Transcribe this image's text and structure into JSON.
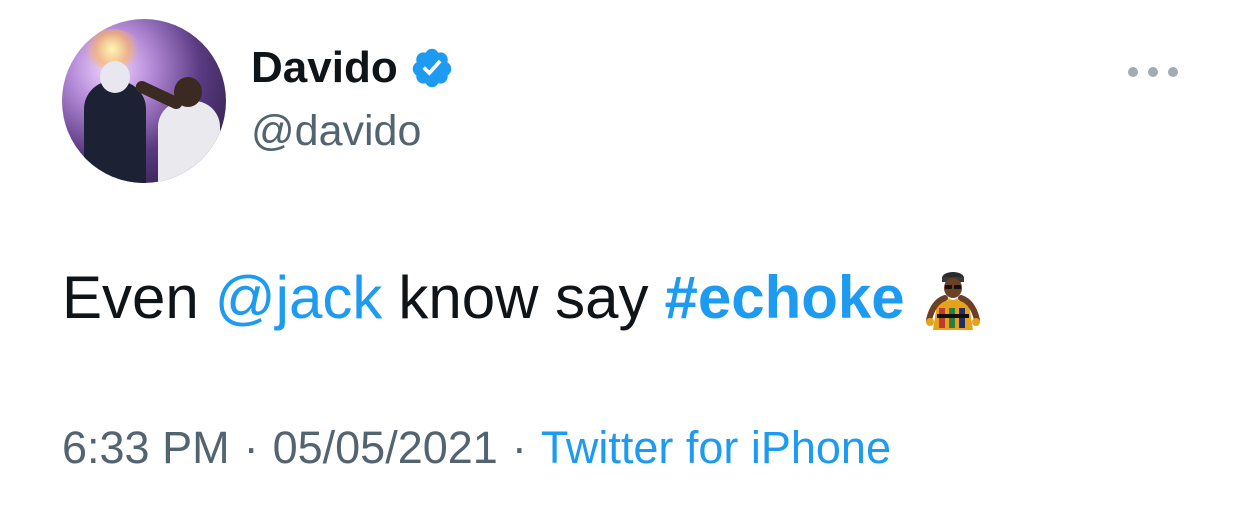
{
  "author": {
    "display_name": "Davido",
    "handle": "@davido",
    "verified": true
  },
  "tweet": {
    "text_before": "Even",
    "mention": "@jack",
    "text_middle": "know say",
    "hashtag": "#echoke",
    "emoji": "echoke-hashflag-icon"
  },
  "meta": {
    "time": "6:33 PM",
    "separator": "·",
    "date": "05/05/2021",
    "source": "Twitter for iPhone"
  },
  "colors": {
    "accent": "#1d9bf0",
    "text": "#0f1419",
    "secondary": "#536471",
    "background": "#ffffff"
  },
  "icons": {
    "verified": "verified-badge-icon",
    "more": "more-options-icon"
  }
}
